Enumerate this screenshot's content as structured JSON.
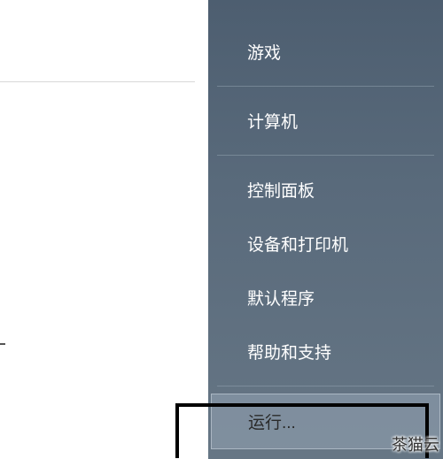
{
  "menu": {
    "items": [
      {
        "label": "游戏"
      },
      {
        "label": "计算机"
      },
      {
        "label": "控制面板"
      },
      {
        "label": "设备和打印机"
      },
      {
        "label": "默认程序"
      },
      {
        "label": "帮助和支持"
      },
      {
        "label": "运行..."
      }
    ]
  },
  "watermark": "茶猫云"
}
